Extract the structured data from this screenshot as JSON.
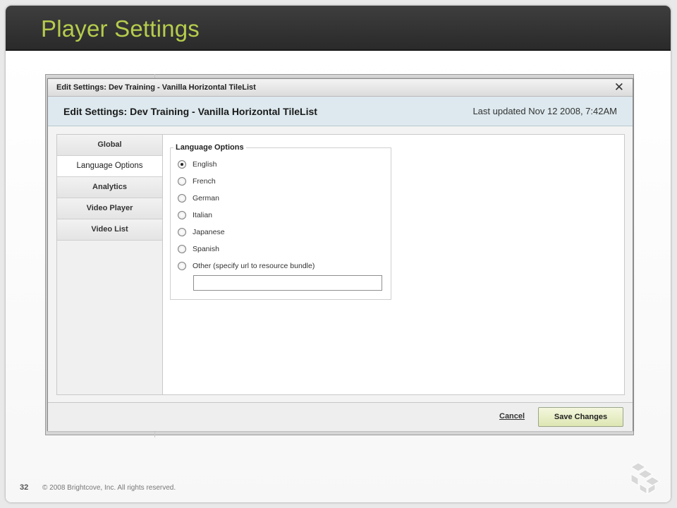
{
  "slide": {
    "title": "Player Settings",
    "page_number": "32",
    "copyright": "© 2008 Brightcove, Inc. All rights reserved."
  },
  "dialog": {
    "titlebar": "Edit Settings: Dev Training - Vanilla Horizontal TileList",
    "close_glyph": "✕",
    "header_title": "Edit Settings: Dev Training - Vanilla Horizontal TileList",
    "last_updated": "Last updated Nov 12 2008, 7:42AM"
  },
  "nav": {
    "items": [
      {
        "label": "Global",
        "active": false
      },
      {
        "label": "Language Options",
        "active": true
      },
      {
        "label": "Analytics",
        "active": false
      },
      {
        "label": "Video Player",
        "active": false
      },
      {
        "label": "Video List",
        "active": false
      }
    ]
  },
  "language_options": {
    "legend": "Language Options",
    "selected": "English",
    "options": [
      "English",
      "French",
      "German",
      "Italian",
      "Japanese",
      "Spanish",
      "Other (specify url to resource bundle)"
    ],
    "url_value": ""
  },
  "footer": {
    "cancel_label": "Cancel",
    "save_label": "Save Changes"
  },
  "colors": {
    "title_accent": "#b5cc4c",
    "header_bar": "#2f2f2f",
    "dialog_header_bg": "#dde9ee",
    "save_button_bg": "#e8eec6"
  }
}
